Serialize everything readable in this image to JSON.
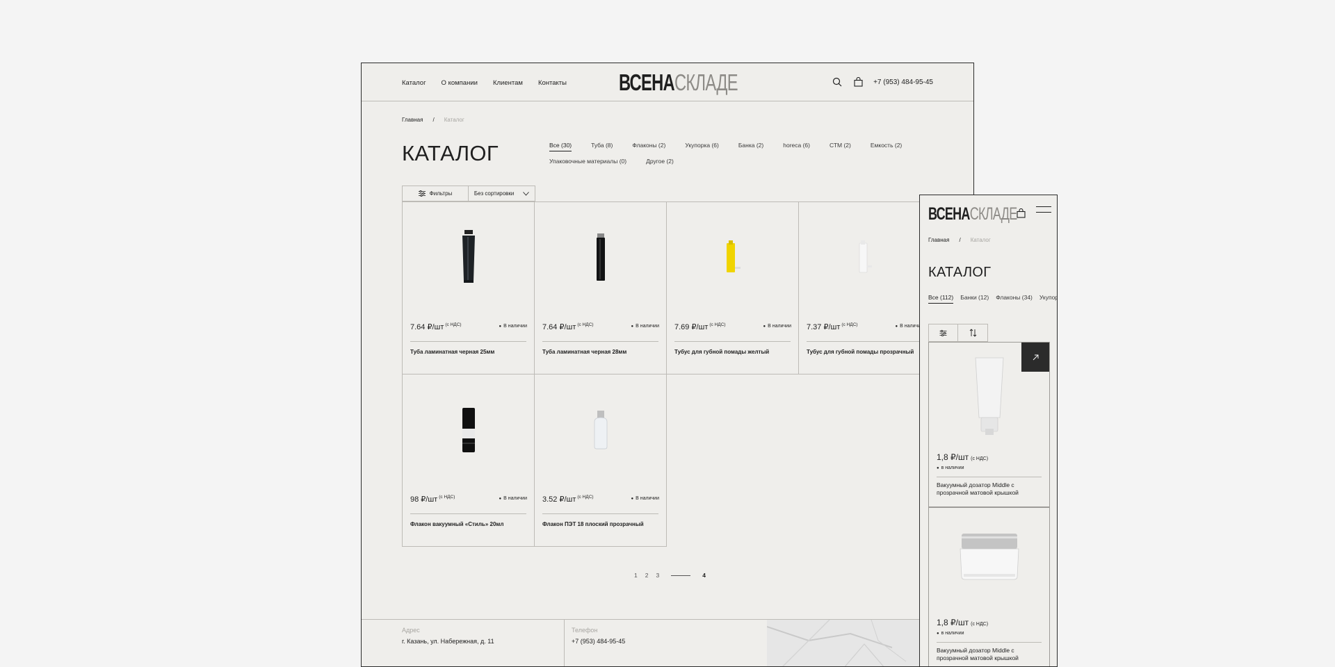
{
  "desktop": {
    "nav": [
      "Каталог",
      "О компании",
      "Клиентам",
      "Контакты"
    ],
    "logo": {
      "part1": "ВСЕНА",
      "part2": "СКЛАДЕ"
    },
    "phone": "+7 (953) 484-95-45",
    "breadcrumb": {
      "home": "Главная",
      "sep": "/",
      "current": "Каталог"
    },
    "title": "КАТАЛОГ",
    "tabs": [
      "Все (30)",
      "Туба (8)",
      "Флаконы (2)",
      "Укупорка (6)",
      "Банка (2)",
      "horeca (6)",
      "СТМ (2)",
      "Емкость (2)",
      "Упаковочные материалы (0)",
      "Другое (2)"
    ],
    "filters_label": "Фильтры",
    "sort_label": "Без сортировки",
    "products": [
      {
        "price": "7.64 ₽/шт",
        "vat": "(с НДС)",
        "stock": "В наличии",
        "name": "Туба ламинатная черная 25мм"
      },
      {
        "price": "7.64 ₽/шт",
        "vat": "(с НДС)",
        "stock": "В наличии",
        "name": "Туба ламинатная черная 28мм"
      },
      {
        "price": "7.69 ₽/шт",
        "vat": "(с НДС)",
        "stock": "В наличии",
        "name": "Тубус для губной помады желтый"
      },
      {
        "price": "7.37 ₽/шт",
        "vat": "(с НДС)",
        "stock": "В наличии",
        "name": "Тубус для губной помады прозрачный"
      },
      {
        "price": "98 ₽/шт",
        "vat": "(с НДС)",
        "stock": "В наличии",
        "name": "Флакон вакуумный «Стиль» 20мл"
      },
      {
        "price": "3.52 ₽/шт",
        "vat": "(с НДС)",
        "stock": "В наличии",
        "name": "Флакон ПЭТ 18 плоский прозрачный"
      }
    ],
    "pages": [
      "1",
      "2",
      "3",
      "4"
    ],
    "footer": {
      "address_label": "Адрес",
      "address": "г. Казань, ул. Набережная, д. 11",
      "phone_label": "Телефон",
      "phone": "+7 (953) 484-95-45"
    }
  },
  "mobile": {
    "logo": {
      "part1": "ВСЕНА",
      "part2": "СКЛАДЕ"
    },
    "breadcrumb": {
      "home": "Главная",
      "sep": "/",
      "current": "Каталог"
    },
    "title": "КАТАЛОГ",
    "tabs": [
      "Все (112)",
      "Банки (12)",
      "Флаконы (34)",
      "Укупорка"
    ],
    "products": [
      {
        "price": "1,8 ₽/шт",
        "vat": "(с НДС)",
        "stock": "в наличии",
        "name": "Вакуумный дозатор Middle с прозрачной матовой крышкой"
      },
      {
        "price": "1,8 ₽/шт",
        "vat": "(с НДС)",
        "stock": "в наличии",
        "name": "Вакуумный дозатор Middle с прозрачной матовой крышкой"
      }
    ]
  },
  "colors": {
    "bg": "#f4f4f4",
    "panel": "#efeeeb",
    "ink": "#1f1f1f",
    "muted": "#a7a5a1",
    "accent_yellow": "#f0d400"
  }
}
